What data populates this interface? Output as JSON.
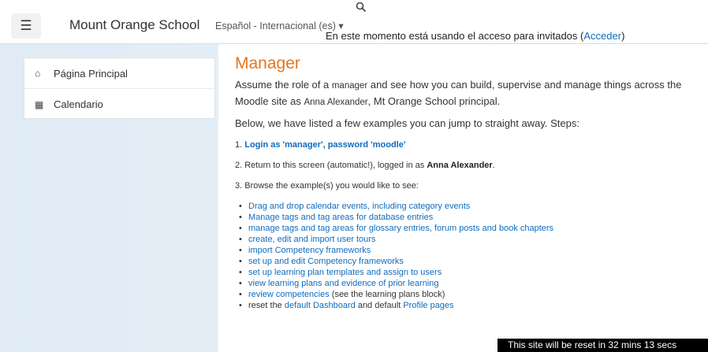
{
  "navbar": {
    "menu_icon": "hamburger-menu-icon",
    "site_name": "Mount Orange School",
    "language": "Español - Internacional (es)",
    "language_caret": "▾",
    "search_icon": "search-icon",
    "guest_text": "En este momento está usando el acceso para invitados (",
    "login_link": "Acceder",
    "guest_close": ")"
  },
  "sidebar": {
    "items": [
      {
        "label": "Página Principal",
        "icon": "home-icon"
      },
      {
        "label": "Calendario",
        "icon": "calendar-icon"
      }
    ]
  },
  "main": {
    "title": "Manager",
    "intro": {
      "a": "Assume the role of a ",
      "b": "manager",
      "c": " and see how you can build, supervise and manage things across the Moodle site as ",
      "d": "Anna Alexander",
      "e": ", Mt Orange School principal."
    },
    "steps_intro": "Below, we have listed a few examples you can jump to straight away. Steps:",
    "step1_prefix": "1. ",
    "step1_link": "Login as 'manager', password 'moodle'",
    "step2_prefix": "2. Return to this screen (automatic!), logged in as ",
    "step2_name": "Anna Alexander",
    "step2_suffix": ".",
    "step3": "3. Browse the example(s) you would like to see:",
    "examples": [
      "Drag and drop calendar events, including category events",
      "Manage tags and tag areas for database entries",
      "manage tags and tag areas for glossary entries, forum posts and book chapters",
      "create, edit and import user tours",
      "import Competency frameworks",
      "set up and edit Competency frameworks",
      "set up learning plan templates and assign to users",
      "view learning plans and evidence of prior learning"
    ],
    "review_link": "review competencies",
    "review_suffix": " (see the learning plans block)",
    "reset_prefix": "reset the ",
    "reset_link1": "default Dashboard",
    "reset_mid": " and default ",
    "reset_link2": "Profile pages"
  },
  "reset_notice": "This site will be reset in 32 mins 13 secs"
}
